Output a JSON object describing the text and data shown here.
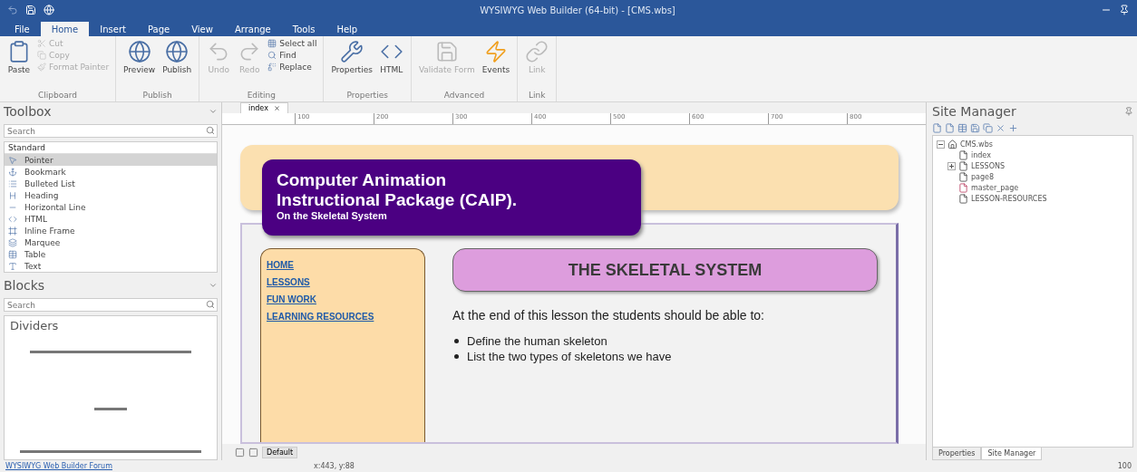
{
  "window": {
    "title": "WYSIWYG Web Builder (64-bit) - [CMS.wbs]"
  },
  "menu_tabs": [
    {
      "label": "File",
      "selected": false
    },
    {
      "label": "Home",
      "selected": true
    },
    {
      "label": "Insert",
      "selected": false
    },
    {
      "label": "Page",
      "selected": false
    },
    {
      "label": "View",
      "selected": false
    },
    {
      "label": "Arrange",
      "selected": false
    },
    {
      "label": "Tools",
      "selected": false
    },
    {
      "label": "Help",
      "selected": false
    }
  ],
  "ribbon_groups": [
    {
      "title": "Clipboard",
      "buttons": [
        {
          "kind": "large",
          "label": "Paste",
          "disabled": false
        },
        {
          "kind": "small",
          "label": "Cut",
          "disabled": true
        },
        {
          "kind": "small",
          "label": "Copy",
          "disabled": true
        },
        {
          "kind": "small",
          "label": "Format Painter",
          "disabled": true
        }
      ]
    },
    {
      "title": "Publish",
      "buttons": [
        {
          "kind": "large",
          "label": "Preview",
          "disabled": false
        },
        {
          "kind": "large",
          "label": "Publish",
          "disabled": false
        }
      ]
    },
    {
      "title": "Editing",
      "buttons": [
        {
          "kind": "large",
          "label": "Undo",
          "disabled": true
        },
        {
          "kind": "large",
          "label": "Redo",
          "disabled": true
        },
        {
          "kind": "small",
          "label": "Select all",
          "disabled": false
        },
        {
          "kind": "small",
          "label": "Find",
          "disabled": false
        },
        {
          "kind": "small",
          "label": "Replace",
          "disabled": false
        }
      ]
    },
    {
      "title": "Properties",
      "buttons": [
        {
          "kind": "large",
          "label": "Properties",
          "disabled": false
        },
        {
          "kind": "large",
          "label": "HTML",
          "disabled": false
        }
      ]
    },
    {
      "title": "Advanced",
      "buttons": [
        {
          "kind": "large",
          "label": "Validate Form",
          "disabled": true
        },
        {
          "kind": "large",
          "label": "Events",
          "disabled": false
        }
      ]
    },
    {
      "title": "Link",
      "buttons": [
        {
          "kind": "large",
          "label": "Link",
          "disabled": true
        }
      ]
    }
  ],
  "toolbox": {
    "title": "Toolbox",
    "search": {
      "placeholder": "Search"
    },
    "category": "Standard",
    "items": [
      {
        "label": "Pointer",
        "selected": true
      },
      {
        "label": "Bookmark",
        "selected": false
      },
      {
        "label": "Bulleted List",
        "selected": false
      },
      {
        "label": "Heading",
        "selected": false
      },
      {
        "label": "Horizontal Line",
        "selected": false
      },
      {
        "label": "HTML",
        "selected": false
      },
      {
        "label": "Inline Frame",
        "selected": false
      },
      {
        "label": "Marquee",
        "selected": false
      },
      {
        "label": "Table",
        "selected": false
      },
      {
        "label": "Text",
        "selected": false
      }
    ]
  },
  "blocks": {
    "title": "Blocks",
    "search": {
      "placeholder": "Search"
    },
    "category": "Dividers"
  },
  "document_tab": {
    "label": "index"
  },
  "ruler": {
    "ticks": [
      "100",
      "200",
      "300",
      "400",
      "500",
      "600",
      "700",
      "800"
    ]
  },
  "page": {
    "title_line_1": "Computer Animation",
    "title_line_2": "Instructional Package (CAIP).",
    "subtitle": "On the Skeletal System",
    "nav": [
      "HOME",
      "LESSONS",
      "FUN WORK",
      "LEARNING RESOURCES"
    ],
    "heading": "THE SKELETAL SYSTEM",
    "intro": "At the end of this lesson the students should be able to:",
    "bullets": [
      "Define the human skeleton",
      "List the two types of skeletons we have"
    ]
  },
  "layout_tab": {
    "label": "Default"
  },
  "site_manager": {
    "title": "Site Manager",
    "tree": [
      {
        "label": "CMS.wbs",
        "kind": "site",
        "expanded": true,
        "children": [
          {
            "label": "index",
            "kind": "page"
          },
          {
            "label": "LESSONS",
            "kind": "page",
            "expanded": false
          },
          {
            "label": "page8",
            "kind": "page"
          },
          {
            "label": "master_page",
            "kind": "master"
          },
          {
            "label": "LESSON-RESOURCES",
            "kind": "page"
          }
        ]
      }
    ],
    "tabs": [
      {
        "label": "Properties",
        "selected": false
      },
      {
        "label": "Site Manager",
        "selected": true
      }
    ]
  },
  "status_bar": {
    "link": "WYSIWYG Web Builder Forum",
    "position": "x:443, y:88",
    "zoom": "100"
  }
}
